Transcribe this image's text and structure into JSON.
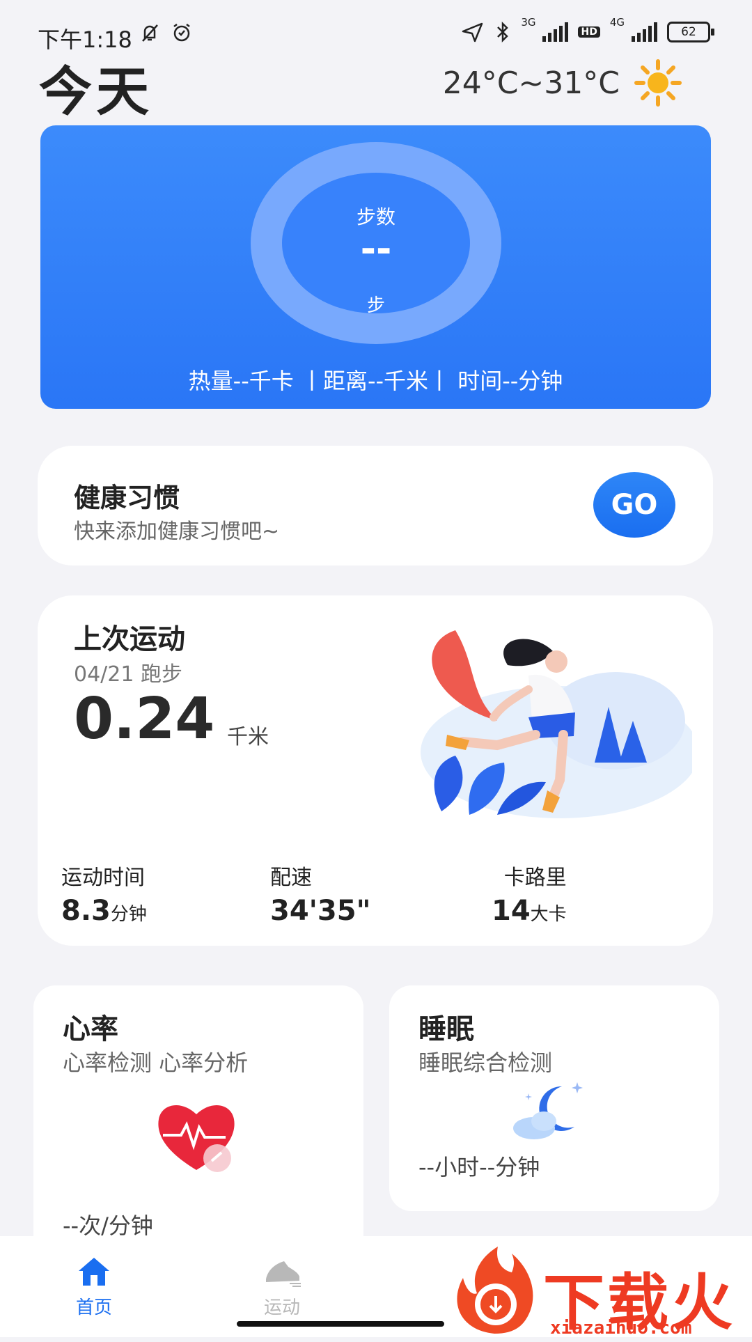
{
  "status_bar": {
    "time": "下午1:18",
    "net1_label": "3G",
    "net2_label": "4G",
    "hd_label": "HD",
    "battery": "62"
  },
  "header": {
    "title": "今天",
    "weather": "24°C~31°C"
  },
  "steps_card": {
    "label": "步数",
    "value": "--",
    "unit": "步",
    "stats": "热量--千卡 丨距离--千米丨 时间--分钟"
  },
  "habit_card": {
    "title": "健康习惯",
    "subtitle": "快来添加健康习惯吧~",
    "go_label": "GO"
  },
  "last_sport": {
    "title": "上次运动",
    "date": "04/21 跑步",
    "distance": "0.24",
    "distance_unit": "千米",
    "stats": [
      {
        "label": "运动时间",
        "value": "8.3",
        "unit": "分钟"
      },
      {
        "label": "配速",
        "value": "34'35\"",
        "unit": ""
      },
      {
        "label": "卡路里",
        "value": "14",
        "unit": "大卡"
      }
    ]
  },
  "heart_card": {
    "title": "心率",
    "subtitle": "心率检测 心率分析",
    "value": "--次/分钟"
  },
  "sleep_card": {
    "title": "睡眠",
    "subtitle": "睡眠综合检测",
    "value": "--小时--分钟"
  },
  "nav": {
    "items": [
      {
        "label": "首页",
        "icon": "home-icon",
        "active": true
      },
      {
        "label": "运动",
        "icon": "shoe-icon",
        "active": false
      }
    ]
  },
  "watermark": {
    "brand": "下载火",
    "url": "xiazaihuo.com"
  },
  "colors": {
    "accent": "#2a76f6",
    "active_nav": "#1a6ef0",
    "inactive_nav": "#b8b8b8"
  }
}
